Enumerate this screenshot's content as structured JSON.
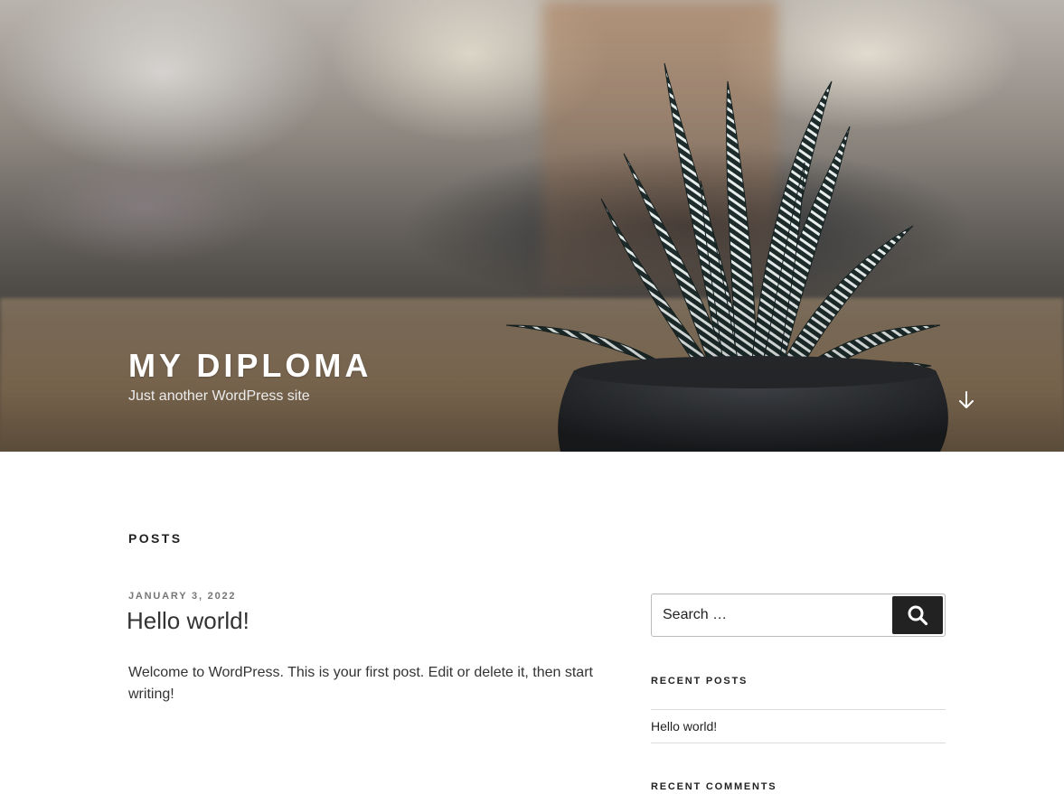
{
  "header": {
    "site_title": "MY DIPLOMA",
    "site_description": "Just another WordPress site",
    "scroll_icon": "arrow-down-icon"
  },
  "main": {
    "page_title": "POSTS",
    "posts": [
      {
        "date": "JANUARY 3, 2022",
        "title": "Hello world!",
        "excerpt": "Welcome to WordPress. This is your first post. Edit or delete it, then start writing!"
      }
    ]
  },
  "sidebar": {
    "search": {
      "placeholder": "Search …",
      "button_icon": "search-icon"
    },
    "recent_posts": {
      "title": "RECENT POSTS",
      "items": [
        "Hello world!"
      ]
    },
    "recent_comments": {
      "title": "RECENT COMMENTS"
    }
  },
  "colors": {
    "text": "#333333",
    "heading": "#222222",
    "meta": "#767676",
    "button_bg": "#222222",
    "border": "#bbbbbb"
  }
}
